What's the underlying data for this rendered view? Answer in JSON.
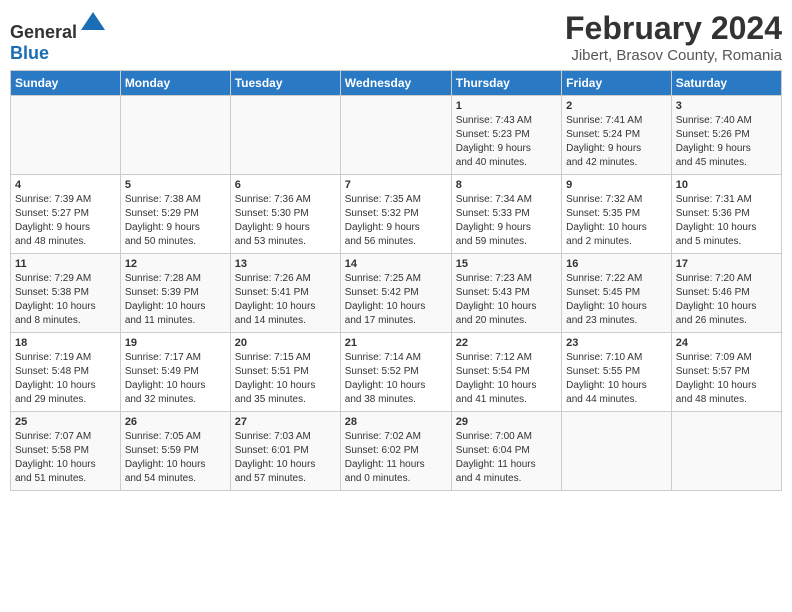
{
  "header": {
    "logo_general": "General",
    "logo_blue": "Blue",
    "month_title": "February 2024",
    "location": "Jibert, Brasov County, Romania"
  },
  "days_of_week": [
    "Sunday",
    "Monday",
    "Tuesday",
    "Wednesday",
    "Thursday",
    "Friday",
    "Saturday"
  ],
  "weeks": [
    [
      {
        "day": "",
        "info": ""
      },
      {
        "day": "",
        "info": ""
      },
      {
        "day": "",
        "info": ""
      },
      {
        "day": "",
        "info": ""
      },
      {
        "day": "1",
        "info": "Sunrise: 7:43 AM\nSunset: 5:23 PM\nDaylight: 9 hours\nand 40 minutes."
      },
      {
        "day": "2",
        "info": "Sunrise: 7:41 AM\nSunset: 5:24 PM\nDaylight: 9 hours\nand 42 minutes."
      },
      {
        "day": "3",
        "info": "Sunrise: 7:40 AM\nSunset: 5:26 PM\nDaylight: 9 hours\nand 45 minutes."
      }
    ],
    [
      {
        "day": "4",
        "info": "Sunrise: 7:39 AM\nSunset: 5:27 PM\nDaylight: 9 hours\nand 48 minutes."
      },
      {
        "day": "5",
        "info": "Sunrise: 7:38 AM\nSunset: 5:29 PM\nDaylight: 9 hours\nand 50 minutes."
      },
      {
        "day": "6",
        "info": "Sunrise: 7:36 AM\nSunset: 5:30 PM\nDaylight: 9 hours\nand 53 minutes."
      },
      {
        "day": "7",
        "info": "Sunrise: 7:35 AM\nSunset: 5:32 PM\nDaylight: 9 hours\nand 56 minutes."
      },
      {
        "day": "8",
        "info": "Sunrise: 7:34 AM\nSunset: 5:33 PM\nDaylight: 9 hours\nand 59 minutes."
      },
      {
        "day": "9",
        "info": "Sunrise: 7:32 AM\nSunset: 5:35 PM\nDaylight: 10 hours\nand 2 minutes."
      },
      {
        "day": "10",
        "info": "Sunrise: 7:31 AM\nSunset: 5:36 PM\nDaylight: 10 hours\nand 5 minutes."
      }
    ],
    [
      {
        "day": "11",
        "info": "Sunrise: 7:29 AM\nSunset: 5:38 PM\nDaylight: 10 hours\nand 8 minutes."
      },
      {
        "day": "12",
        "info": "Sunrise: 7:28 AM\nSunset: 5:39 PM\nDaylight: 10 hours\nand 11 minutes."
      },
      {
        "day": "13",
        "info": "Sunrise: 7:26 AM\nSunset: 5:41 PM\nDaylight: 10 hours\nand 14 minutes."
      },
      {
        "day": "14",
        "info": "Sunrise: 7:25 AM\nSunset: 5:42 PM\nDaylight: 10 hours\nand 17 minutes."
      },
      {
        "day": "15",
        "info": "Sunrise: 7:23 AM\nSunset: 5:43 PM\nDaylight: 10 hours\nand 20 minutes."
      },
      {
        "day": "16",
        "info": "Sunrise: 7:22 AM\nSunset: 5:45 PM\nDaylight: 10 hours\nand 23 minutes."
      },
      {
        "day": "17",
        "info": "Sunrise: 7:20 AM\nSunset: 5:46 PM\nDaylight: 10 hours\nand 26 minutes."
      }
    ],
    [
      {
        "day": "18",
        "info": "Sunrise: 7:19 AM\nSunset: 5:48 PM\nDaylight: 10 hours\nand 29 minutes."
      },
      {
        "day": "19",
        "info": "Sunrise: 7:17 AM\nSunset: 5:49 PM\nDaylight: 10 hours\nand 32 minutes."
      },
      {
        "day": "20",
        "info": "Sunrise: 7:15 AM\nSunset: 5:51 PM\nDaylight: 10 hours\nand 35 minutes."
      },
      {
        "day": "21",
        "info": "Sunrise: 7:14 AM\nSunset: 5:52 PM\nDaylight: 10 hours\nand 38 minutes."
      },
      {
        "day": "22",
        "info": "Sunrise: 7:12 AM\nSunset: 5:54 PM\nDaylight: 10 hours\nand 41 minutes."
      },
      {
        "day": "23",
        "info": "Sunrise: 7:10 AM\nSunset: 5:55 PM\nDaylight: 10 hours\nand 44 minutes."
      },
      {
        "day": "24",
        "info": "Sunrise: 7:09 AM\nSunset: 5:57 PM\nDaylight: 10 hours\nand 48 minutes."
      }
    ],
    [
      {
        "day": "25",
        "info": "Sunrise: 7:07 AM\nSunset: 5:58 PM\nDaylight: 10 hours\nand 51 minutes."
      },
      {
        "day": "26",
        "info": "Sunrise: 7:05 AM\nSunset: 5:59 PM\nDaylight: 10 hours\nand 54 minutes."
      },
      {
        "day": "27",
        "info": "Sunrise: 7:03 AM\nSunset: 6:01 PM\nDaylight: 10 hours\nand 57 minutes."
      },
      {
        "day": "28",
        "info": "Sunrise: 7:02 AM\nSunset: 6:02 PM\nDaylight: 11 hours\nand 0 minutes."
      },
      {
        "day": "29",
        "info": "Sunrise: 7:00 AM\nSunset: 6:04 PM\nDaylight: 11 hours\nand 4 minutes."
      },
      {
        "day": "",
        "info": ""
      },
      {
        "day": "",
        "info": ""
      }
    ]
  ]
}
